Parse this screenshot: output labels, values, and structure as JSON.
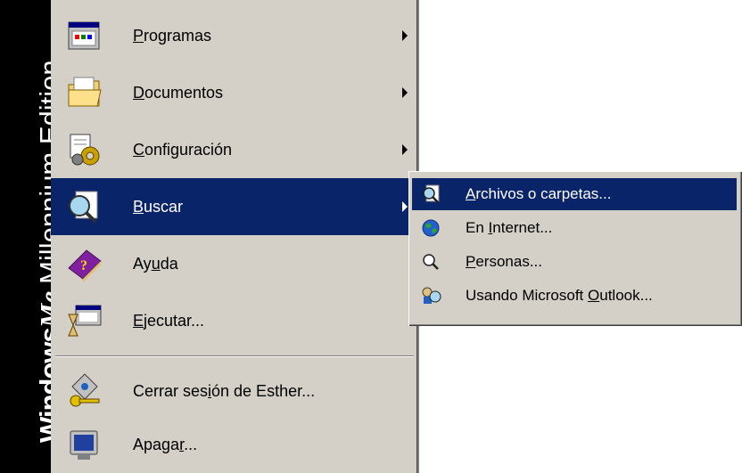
{
  "banner": {
    "brand": "Windows",
    "me": "Me",
    "edition": "Millennium Edition"
  },
  "menu": {
    "items": [
      {
        "icon": "programs-icon",
        "pre": "",
        "ul": "P",
        "post": "rogramas",
        "has_submenu": true
      },
      {
        "icon": "documents-icon",
        "pre": "",
        "ul": "D",
        "post": "ocumentos",
        "has_submenu": true
      },
      {
        "icon": "settings-icon",
        "pre": "",
        "ul": "C",
        "post": "onfiguración",
        "has_submenu": true
      },
      {
        "icon": "search-icon",
        "pre": "",
        "ul": "B",
        "post": "uscar",
        "has_submenu": true,
        "selected": true
      },
      {
        "icon": "help-icon",
        "pre": "Ay",
        "ul": "u",
        "post": "da",
        "has_submenu": false
      },
      {
        "icon": "run-icon",
        "pre": "",
        "ul": "E",
        "post": "jecutar...",
        "has_submenu": false
      },
      {
        "icon": "logoff-icon",
        "pre": "Cerrar ses",
        "ul": "i",
        "post": "ón de Esther...",
        "has_submenu": false
      },
      {
        "icon": "shutdown-icon",
        "pre": "Apaga",
        "ul": "r",
        "post": "...",
        "has_submenu": false
      }
    ]
  },
  "submenu": {
    "items": [
      {
        "icon": "find-files-icon",
        "pre": "",
        "ul": "A",
        "post": "rchivos o carpetas...",
        "selected": true
      },
      {
        "icon": "internet-globe-icon",
        "pre": "En ",
        "ul": "I",
        "post": "nternet...",
        "selected": false
      },
      {
        "icon": "find-people-icon",
        "pre": "",
        "ul": "P",
        "post": "ersonas...",
        "selected": false
      },
      {
        "icon": "outlook-icon",
        "pre": "Usando Microsoft ",
        "ul": "O",
        "post": "utlook...",
        "selected": false
      }
    ]
  },
  "colors": {
    "menu_bg": "#d4d0c8",
    "selection": "#0a246a",
    "banner_bg": "#000000"
  }
}
